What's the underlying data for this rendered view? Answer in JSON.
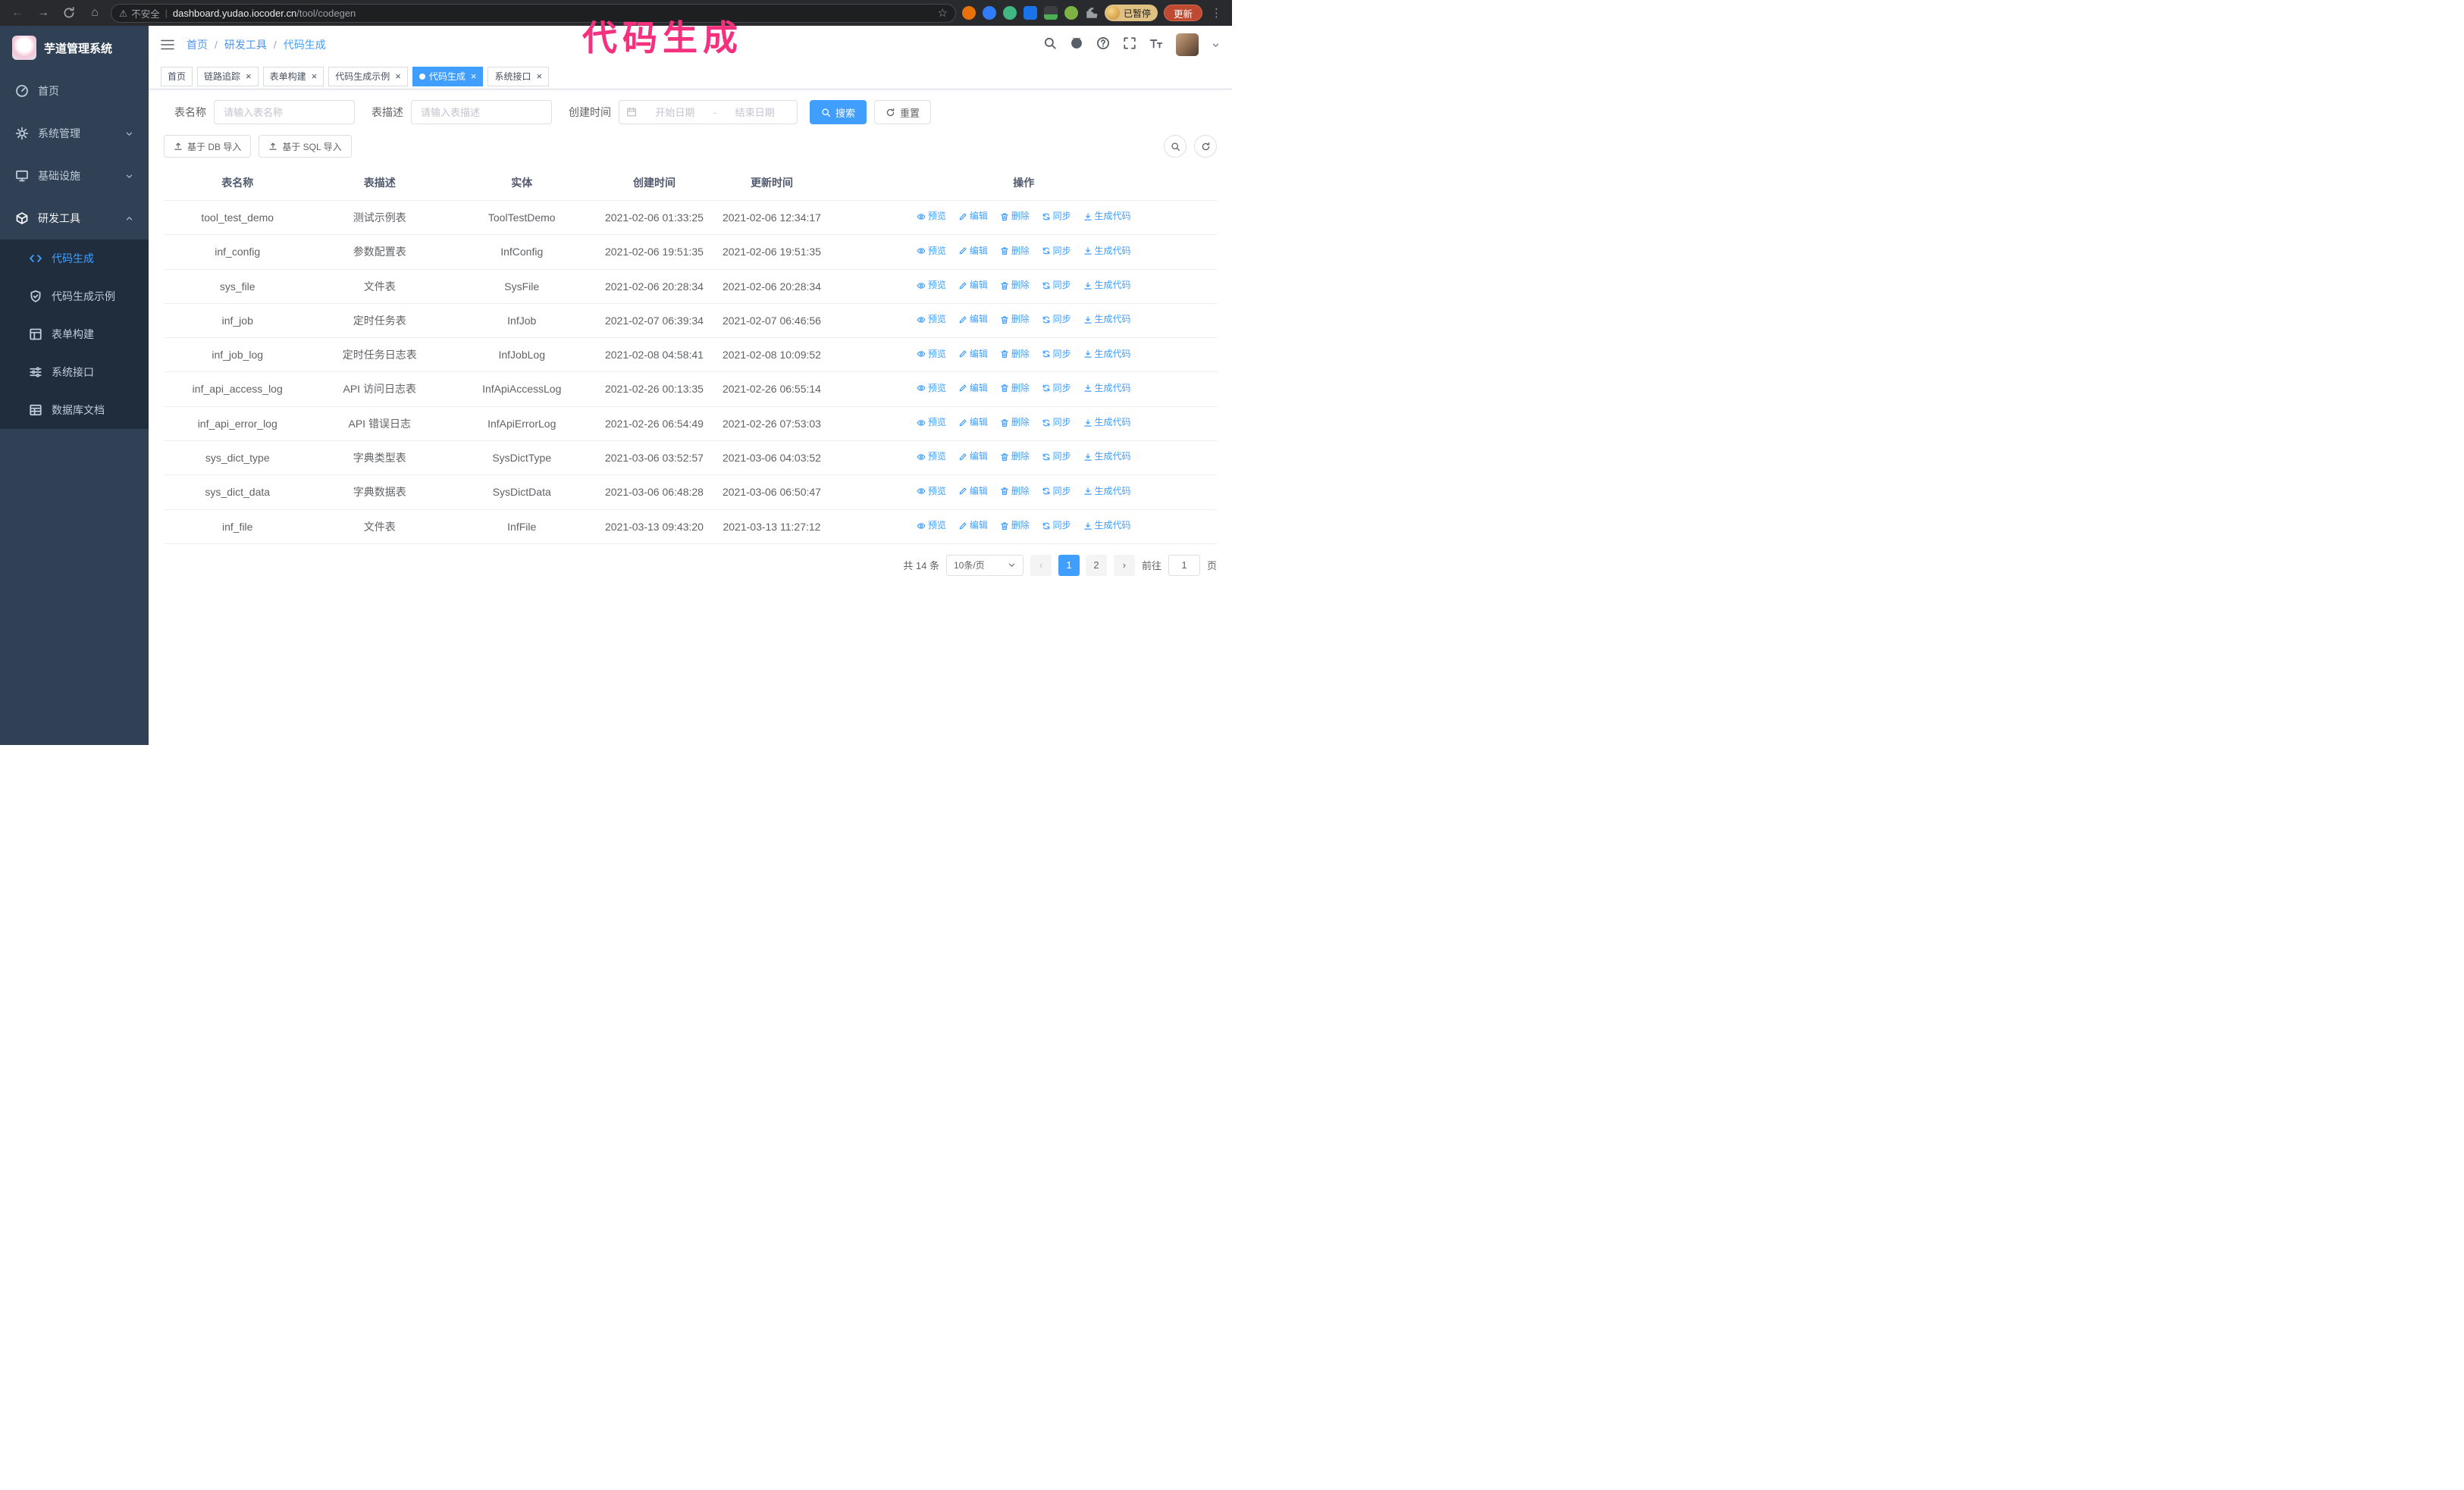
{
  "browser": {
    "security_label": "不安全",
    "url_domain": "dashboard.yudao.iocoder.cn",
    "url_path": "/tool/codegen",
    "paused_badge": "已暂停",
    "update_button": "更新",
    "extension_icons": [
      "orange-extension-icon",
      "blue-drop-extension-icon",
      "vue-devtools-icon",
      "blue-people-extension-icon",
      "dark-extension-icon",
      "green-leaf-extension-icon",
      "puzzle-extensions-icon"
    ]
  },
  "annotation": {
    "text": "代码生成",
    "color": "#f5317f"
  },
  "sidebar": {
    "logo_title": "芋道管理系统",
    "menu": [
      {
        "label": "首页",
        "icon": "dashboard-icon"
      },
      {
        "label": "系统管理",
        "icon": "gear-icon",
        "expandable": true
      },
      {
        "label": "基础设施",
        "icon": "monitor-icon",
        "expandable": true
      },
      {
        "label": "研发工具",
        "icon": "toolbox-icon",
        "expandable": true,
        "expanded": true
      }
    ],
    "submenu": [
      {
        "label": "代码生成",
        "icon": "code-icon",
        "active": true
      },
      {
        "label": "代码生成示例",
        "icon": "shield-check-icon"
      },
      {
        "label": "表单构建",
        "icon": "form-grid-icon"
      },
      {
        "label": "系统接口",
        "icon": "sliders-icon"
      },
      {
        "label": "数据库文档",
        "icon": "database-doc-icon"
      }
    ]
  },
  "navbar": {
    "breadcrumb": [
      "首页",
      "研发工具",
      "代码生成"
    ],
    "separator": "/"
  },
  "tabs": [
    {
      "label": "首页",
      "closable": false
    },
    {
      "label": "链路追踪",
      "closable": true
    },
    {
      "label": "表单构建",
      "closable": true
    },
    {
      "label": "代码生成示例",
      "closable": true
    },
    {
      "label": "代码生成",
      "closable": true,
      "active": true
    },
    {
      "label": "系统接口",
      "closable": true
    }
  ],
  "filters": {
    "table_name_label": "表名称",
    "table_name_placeholder": "请输入表名称",
    "table_desc_label": "表描述",
    "table_desc_placeholder": "请输入表描述",
    "create_time_label": "创建时间",
    "start_date_placeholder": "开始日期",
    "end_date_placeholder": "结束日期",
    "range_separator": "-",
    "search_button": "搜索",
    "reset_button": "重置"
  },
  "toolbar": {
    "import_db_button": "基于 DB 导入",
    "import_sql_button": "基于 SQL 导入"
  },
  "table": {
    "columns": [
      "表名称",
      "表描述",
      "实体",
      "创建时间",
      "更新时间",
      "操作"
    ],
    "actions": [
      {
        "label": "预览",
        "icon": "eye-icon"
      },
      {
        "label": "编辑",
        "icon": "edit-icon"
      },
      {
        "label": "删除",
        "icon": "delete-icon"
      },
      {
        "label": "同步",
        "icon": "sync-icon"
      },
      {
        "label": "生成代码",
        "icon": "download-icon"
      }
    ],
    "rows": [
      {
        "name": "tool_test_demo",
        "desc": "测试示例表",
        "entity": "ToolTestDemo",
        "created": "2021-02-06 01:33:25",
        "updated": "2021-02-06 12:34:17"
      },
      {
        "name": "inf_config",
        "desc": "参数配置表",
        "entity": "InfConfig",
        "created": "2021-02-06 19:51:35",
        "updated": "2021-02-06 19:51:35"
      },
      {
        "name": "sys_file",
        "desc": "文件表",
        "entity": "SysFile",
        "created": "2021-02-06 20:28:34",
        "updated": "2021-02-06 20:28:34"
      },
      {
        "name": "inf_job",
        "desc": "定时任务表",
        "entity": "InfJob",
        "created": "2021-02-07 06:39:34",
        "updated": "2021-02-07 06:46:56"
      },
      {
        "name": "inf_job_log",
        "desc": "定时任务日志表",
        "entity": "InfJobLog",
        "created": "2021-02-08 04:58:41",
        "updated": "2021-02-08 10:09:52"
      },
      {
        "name": "inf_api_access_log",
        "desc": "API 访问日志表",
        "entity": "InfApiAccessLog",
        "created": "2021-02-26 00:13:35",
        "updated": "2021-02-26 06:55:14"
      },
      {
        "name": "inf_api_error_log",
        "desc": "API 错误日志",
        "entity": "InfApiErrorLog",
        "created": "2021-02-26 06:54:49",
        "updated": "2021-02-26 07:53:03"
      },
      {
        "name": "sys_dict_type",
        "desc": "字典类型表",
        "entity": "SysDictType",
        "created": "2021-03-06 03:52:57",
        "updated": "2021-03-06 04:03:52"
      },
      {
        "name": "sys_dict_data",
        "desc": "字典数据表",
        "entity": "SysDictData",
        "created": "2021-03-06 06:48:28",
        "updated": "2021-03-06 06:50:47"
      },
      {
        "name": "inf_file",
        "desc": "文件表",
        "entity": "InfFile",
        "created": "2021-03-13 09:43:20",
        "updated": "2021-03-13 11:27:12"
      }
    ]
  },
  "pagination": {
    "total_label": "共 14 条",
    "page_size": "10条/页",
    "pages": [
      {
        "label": "1",
        "active": true
      },
      {
        "label": "2"
      }
    ],
    "goto_label": "前往",
    "goto_value": "1",
    "goto_suffix": "页"
  },
  "colors": {
    "accent": "#409eff",
    "sidebar_bg": "#304156",
    "submenu_bg": "#1f2d3d",
    "annotation": "#f5317f"
  }
}
